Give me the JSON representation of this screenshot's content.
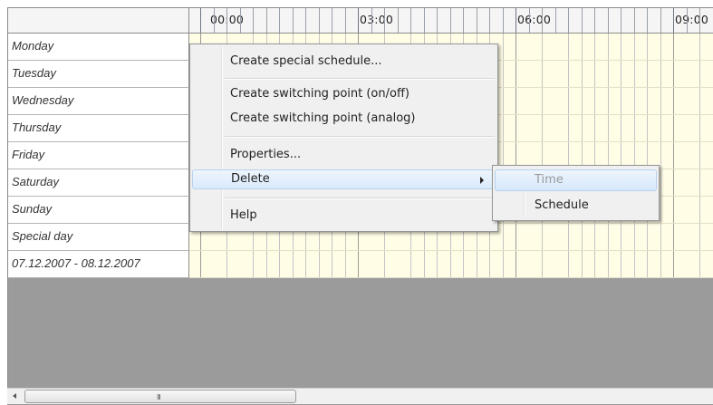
{
  "timeline": {
    "labels": [
      "00:00",
      "03:00",
      "06:00",
      "09:00"
    ]
  },
  "days": [
    "Monday",
    "Tuesday",
    "Wednesday",
    "Thursday",
    "Friday",
    "Saturday",
    "Sunday",
    "Special day",
    "07.12.2007 - 08.12.2007"
  ],
  "context_menu": {
    "create_special": "Create special schedule...",
    "create_switch_onoff": "Create switching point (on/off)",
    "create_switch_analog": "Create switching point (analog)",
    "properties": "Properties...",
    "delete": "Delete",
    "help": "Help"
  },
  "delete_submenu": {
    "time": "Time",
    "schedule": "Schedule"
  },
  "scrollbar": {
    "grip": "III"
  },
  "colors": {
    "grid_background": "#fffde6",
    "empty_area": "#9b9b9b",
    "highlight": "#d9eafb"
  }
}
